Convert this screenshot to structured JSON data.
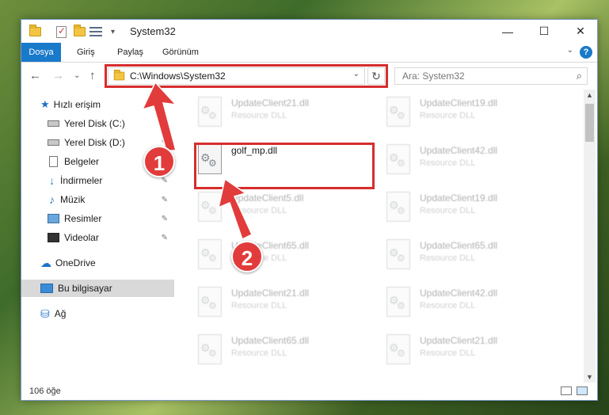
{
  "window": {
    "title": "System32",
    "minimize": "—",
    "maximize": "☐",
    "close": "✕"
  },
  "ribbon": {
    "tabs": [
      "Dosya",
      "Giriş",
      "Paylaş",
      "Görünüm"
    ],
    "help": "?",
    "collapse": "⌄"
  },
  "address": {
    "back": "←",
    "forward": "→",
    "recent": "⌄",
    "up": "↑",
    "path": "C:\\Windows\\System32",
    "dropdown": "⌄",
    "refresh": "↻",
    "search_placeholder": "Ara: System32",
    "search_icon": "⌕"
  },
  "sidebar": {
    "items": [
      {
        "label": "Hızlı erişim",
        "icon": "star-icon"
      },
      {
        "label": "Yerel Disk (C:)",
        "icon": "drive-icon",
        "pinned": true
      },
      {
        "label": "Yerel Disk (D:)",
        "icon": "drive-icon",
        "pinned": true
      },
      {
        "label": "Belgeler",
        "icon": "document-icon",
        "pinned": true
      },
      {
        "label": "İndirmeler",
        "icon": "download-icon",
        "pinned": true
      },
      {
        "label": "Müzik",
        "icon": "music-icon",
        "pinned": true
      },
      {
        "label": "Resimler",
        "icon": "pictures-icon",
        "pinned": true
      },
      {
        "label": "Videolar",
        "icon": "videos-icon",
        "pinned": true
      },
      {
        "label": "OneDrive",
        "icon": "cloud-icon"
      },
      {
        "label": "Bu bilgisayar",
        "icon": "computer-icon",
        "selected": true
      },
      {
        "label": "Ağ",
        "icon": "network-icon"
      }
    ],
    "pin_glyph": "📌"
  },
  "files": {
    "left": [
      {
        "name": "UpdateClient21.dll",
        "type": "Resource DLL"
      },
      {
        "name": "golf_mp.dll",
        "type": ""
      },
      {
        "name": "UpdateClient5.dll",
        "type": "Resource DLL"
      },
      {
        "name": "UpdateClient65.dll",
        "type": "Resource DLL"
      },
      {
        "name": "UpdateClient21.dll",
        "type": "Resource DLL"
      },
      {
        "name": "UpdateClient65.dll",
        "type": "Resource DLL"
      }
    ],
    "right": [
      {
        "name": "UpdateClient19.dll",
        "type": "Resource DLL"
      },
      {
        "name": "UpdateClient42.dll",
        "type": "Resource DLL"
      },
      {
        "name": "UpdateClient19.dll",
        "type": "Resource DLL"
      },
      {
        "name": "UpdateClient65.dll",
        "type": "Resource DLL"
      },
      {
        "name": "UpdateClient42.dll",
        "type": "Resource DLL"
      },
      {
        "name": "UpdateClient21.dll",
        "type": "Resource DLL"
      }
    ]
  },
  "status": {
    "count": "106 öğe"
  },
  "callouts": [
    "1",
    "2"
  ],
  "colors": {
    "accent": "#1979ca",
    "highlight": "#d72d2d",
    "badge": "#e23b3b"
  }
}
